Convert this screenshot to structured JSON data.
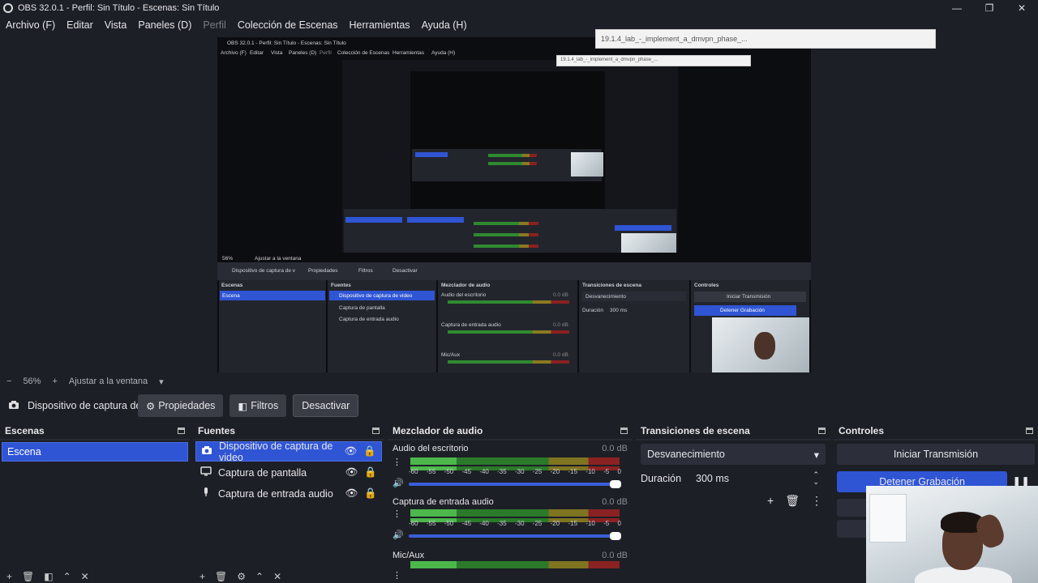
{
  "window": {
    "title": "OBS 32.0.1 - Perfil: Sin Título - Escenas: Sin Título",
    "minimize": "—",
    "maximize": "❐",
    "close": "✕"
  },
  "menu": [
    "Archivo (F)",
    "Editar",
    "Vista",
    "Paneles (D)",
    "Perfil",
    "Colección de Escenas",
    "Herramientas",
    "Ayuda (H)"
  ],
  "notification": {
    "outer": "19.1.4_lab_-_implement_a_dmvpn_phase_...",
    "inner": "19.1.4_lab_-_implement_a_dmvpn_phase_..."
  },
  "nested_preview": {
    "title": "OBS 32.0.1 - Perfil: Sin Título - Escenas: Sin Título",
    "menu": [
      "Archivo (F)",
      "Editar",
      "Vista",
      "Paneles (D)",
      "Perfil",
      "Colección de Escenas",
      "Herramientas",
      "Ayuda (H)"
    ],
    "zoom": "56%",
    "fit": "Ajustar a la ventana",
    "source_name": "Dispositivo de captura de v",
    "properties": "Propiedades",
    "filters": "Filtros",
    "deactivate": "Desactivar",
    "docks": [
      "Escenas",
      "Fuentes",
      "Mezclador de audio",
      "Transiciones de escena",
      "Controles"
    ],
    "scene": "Escena",
    "sources": [
      "Dispositivo de captura de video",
      "Captura de pantalla",
      "Captura de entrada audio"
    ],
    "mixer": [
      "Audio del escritorio",
      "Captura de entrada audio",
      "Mic/Aux"
    ],
    "db": "0.0 dB",
    "transition": "Desvanecimiento",
    "duration_label": "Duración",
    "duration": "300 ms",
    "start_stream": "Iniciar Transmisión",
    "stop_record": "Detener Grabación"
  },
  "zoombar": {
    "minus": "−",
    "zoom": "56%",
    "plus": "+",
    "fit": "Ajustar a la ventana"
  },
  "source_toolbar": {
    "name": "Dispositivo de captura de v",
    "properties": "Propiedades",
    "filters": "Filtros",
    "deactivate": "Desactivar"
  },
  "scenes": {
    "title": "Escenas",
    "items": [
      "Escena"
    ]
  },
  "sources": {
    "title": "Fuentes",
    "items": [
      {
        "label": "Dispositivo de captura de video",
        "icon": "camera-icon"
      },
      {
        "label": "Captura de pantalla",
        "icon": "monitor-icon"
      },
      {
        "label": "Captura de entrada audio",
        "icon": "microphone-icon"
      }
    ]
  },
  "mixer": {
    "title": "Mezclador de audio",
    "ticks": [
      "-60",
      "-55",
      "-50",
      "-45",
      "-40",
      "-35",
      "-30",
      "-25",
      "-20",
      "-15",
      "-10",
      "-5",
      "0"
    ],
    "channels": [
      {
        "name": "Audio del escritorio",
        "db": "0.0 dB"
      },
      {
        "name": "Captura de entrada audio",
        "db": "0.0 dB"
      },
      {
        "name": "Mic/Aux",
        "db": "0.0 dB"
      }
    ]
  },
  "transitions": {
    "title": "Transiciones de escena",
    "selected": "Desvanecimiento",
    "duration_label": "Duración",
    "duration": "300 ms"
  },
  "controls": {
    "title": "Controles",
    "start_stream": "Iniciar Transmisión",
    "stop_record": "Detener Grabación"
  }
}
